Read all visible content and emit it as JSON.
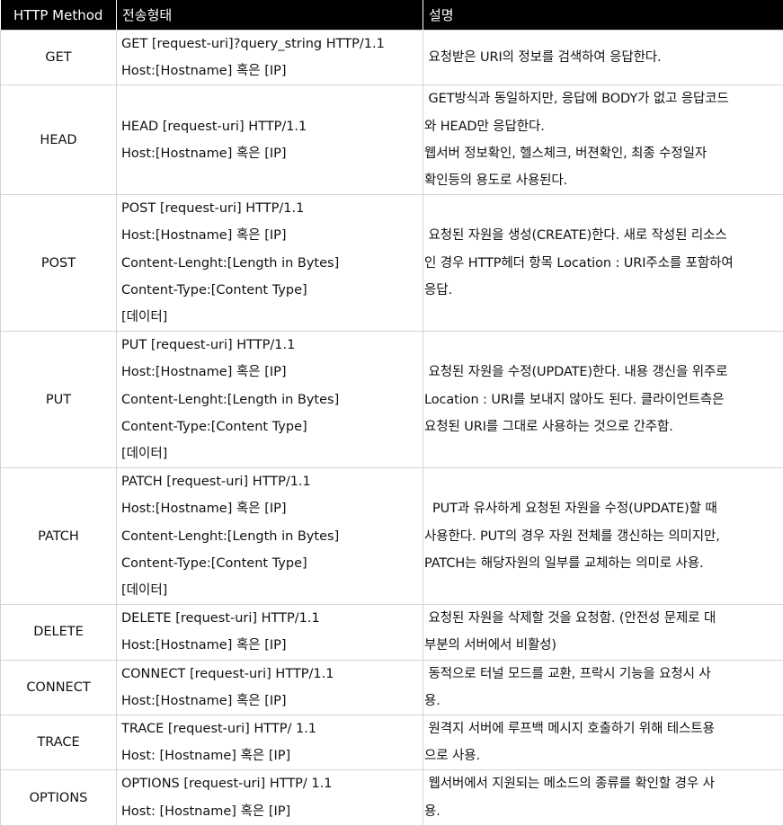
{
  "headers": [
    "HTTP Method",
    "전송형태",
    "설명"
  ],
  "rows": [
    {
      "method": "GET",
      "form": [
        "GET [request-uri]?query_string HTTP/1.1",
        "Host:[Hostname] 혹은 [IP]"
      ],
      "desc": [
        " 요청받은 URI의 정보를 검색하여 응답한다."
      ]
    },
    {
      "method": "HEAD",
      "form": [
        "HEAD [request-uri] HTTP/1.1",
        "Host:[Hostname] 혹은 [IP]"
      ],
      "desc": [
        " GET방식과 동일하지만, 응답에 BODY가 없고 응답코드",
        "와 HEAD만 응답한다.",
        "웹서버 정보확인, 헬스체크, 버젼확인, 최종 수정일자",
        "확인등의 용도로 사용된다."
      ]
    },
    {
      "method": "POST",
      "form": [
        "POST [request-uri] HTTP/1.1",
        "Host:[Hostname] 혹은 [IP]",
        "Content-Lenght:[Length in Bytes]",
        "Content-Type:[Content Type]",
        "[데이터]"
      ],
      "desc": [
        " 요청된 자원을 생성(CREATE)한다. 새로 작성된 리소스",
        "인 경우 HTTP헤더 항목 Location : URI주소를 포함하여",
        "응답."
      ]
    },
    {
      "method": "PUT",
      "form": [
        "PUT [request-uri] HTTP/1.1",
        "Host:[Hostname] 혹은 [IP]",
        "Content-Lenght:[Length in Bytes]",
        "Content-Type:[Content Type]",
        "[데이터]"
      ],
      "desc": [
        " 요청된 자원을 수정(UPDATE)한다. 내용 갱신을 위주로",
        "Location : URI를 보내지 않아도 된다. 클라이언트측은",
        "요청된 URI를 그대로 사용하는 것으로 간주함."
      ]
    },
    {
      "method": "PATCH",
      "form": [
        "PATCH [request-uri] HTTP/1.1",
        "Host:[Hostname] 혹은 [IP]",
        "Content-Lenght:[Length in Bytes]",
        "Content-Type:[Content Type]",
        "[데이터]"
      ],
      "desc": [
        "  PUT과 유사하게 요청된 자원을 수정(UPDATE)할 때",
        "사용한다. PUT의 경우 자원 전체를 갱신하는 의미지만,",
        "PATCH는 해당자원의 일부를 교체하는 의미로 사용."
      ]
    },
    {
      "method": "DELETE",
      "form": [
        "DELETE [request-uri] HTTP/1.1",
        "Host:[Hostname] 혹은 [IP]"
      ],
      "desc": [
        " 요청된 자원을 삭제할 것을 요청함. (안전성 문제로 대",
        "부분의 서버에서 비활성)"
      ]
    },
    {
      "method": "CONNECT",
      "form": [
        "CONNECT [request-uri] HTTP/1.1",
        "Host:[Hostname] 혹은 [IP]"
      ],
      "desc": [
        " 동적으로 터널 모드를 교환, 프락시 기능을 요청시 사",
        "용."
      ]
    },
    {
      "method": "TRACE",
      "form": [
        "TRACE [request-uri] HTTP/ 1.1",
        "Host: [Hostname] 혹은 [IP]"
      ],
      "desc": [
        " 원격지 서버에 루프백 메시지 호출하기 위해 테스트용",
        "으로 사용."
      ]
    },
    {
      "method": "OPTIONS",
      "form": [
        "OPTIONS [request-uri] HTTP/ 1.1",
        "Host: [Hostname] 혹은 [IP]"
      ],
      "desc": [
        " 웹서버에서 지원되는 메소드의 종류를 확인할 경우 사",
        "용."
      ]
    }
  ]
}
